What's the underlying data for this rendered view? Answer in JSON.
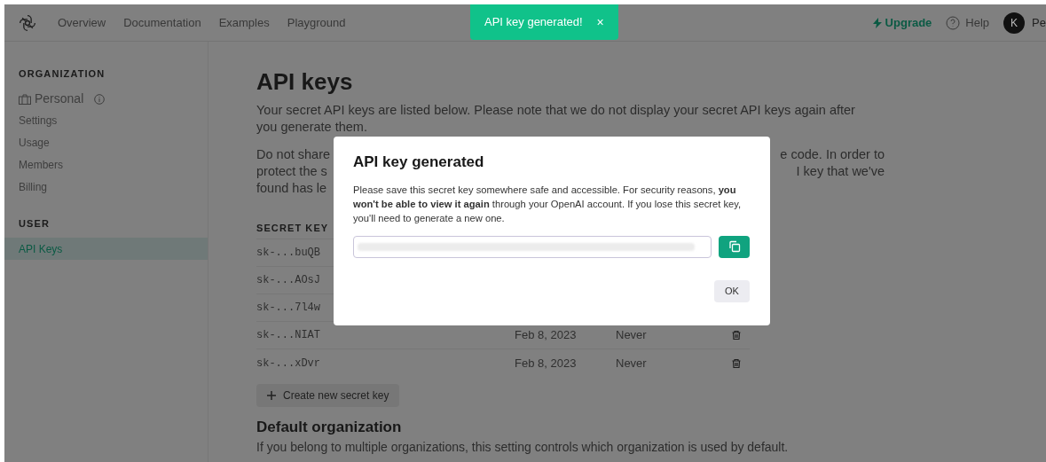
{
  "nav": {
    "links": [
      "Overview",
      "Documentation",
      "Examples",
      "Playground"
    ],
    "upgrade": "Upgrade",
    "help": "Help",
    "avatar": "K",
    "user": "Pe"
  },
  "toast": {
    "message": "API key generated!",
    "close": "×"
  },
  "sidebar": {
    "sections": [
      {
        "heading": "ORGANIZATION",
        "items": [
          {
            "label": "Personal",
            "kind": "org",
            "selected": false
          },
          {
            "label": "Settings",
            "kind": "link",
            "selected": false
          },
          {
            "label": "Usage",
            "kind": "link",
            "selected": false
          },
          {
            "label": "Members",
            "kind": "link",
            "selected": false
          },
          {
            "label": "Billing",
            "kind": "link",
            "selected": false
          }
        ]
      },
      {
        "heading": "USER",
        "items": [
          {
            "label": "API Keys",
            "kind": "link",
            "selected": true
          }
        ]
      }
    ]
  },
  "main": {
    "title": "API keys",
    "intro": "Your secret API keys are listed below. Please note that we do not display your secret API keys again after you generate them.",
    "notice_lines": [
      [
        "Do not share",
        "e code. In order to"
      ],
      [
        "protect the s",
        "I key that we've"
      ],
      [
        "found has le"
      ]
    ],
    "table": {
      "columns": [
        "SECRET KEY"
      ],
      "rows": [
        {
          "key": "sk-...buQB"
        },
        {
          "key": "sk-...AOsJ"
        },
        {
          "key": "sk-...7l4w"
        },
        {
          "key": "sk-...NIAT",
          "created": "Feb 8, 2023",
          "last_used": "Never"
        },
        {
          "key": "sk-...xDvr",
          "created": "Feb 8, 2023",
          "last_used": "Never"
        }
      ]
    },
    "create_button": "Create new secret key",
    "section_title": "Default organization",
    "section_text": "If you belong to multiple organizations, this setting controls which organization is used by default."
  },
  "dialog": {
    "title": "API key generated",
    "message": "Please save this secret key somewhere safe and accessible. For security reasons, **you won't be able to view it again** through your OpenAI account. If you lose this secret key, you'll need to generate a new one.",
    "ok": "OK"
  }
}
